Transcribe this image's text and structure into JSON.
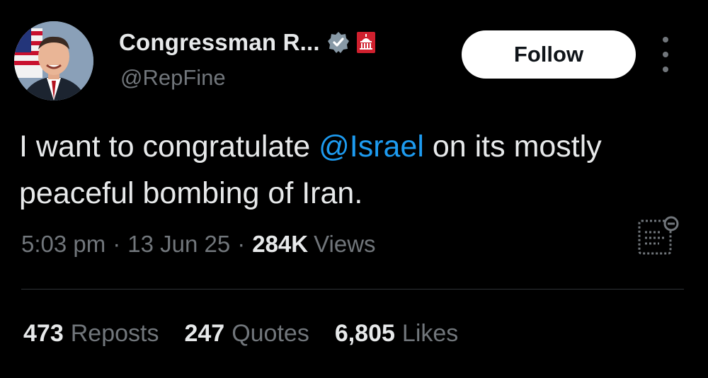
{
  "author": {
    "display_name": "Congressman R...",
    "handle": "@RepFine",
    "verified_icon": "verified-badge-icon",
    "affiliation_icon": "capitol-building-icon"
  },
  "follow_label": "Follow",
  "more_icon": "more-options-icon",
  "tweet": {
    "text_before": "I want to congratulate ",
    "mention": "@Israel",
    "text_after": " on its mostly peaceful bombing of Iran."
  },
  "meta": {
    "time": "5:03 pm",
    "separator": "·",
    "date": "13 Jun 25",
    "views_count": "284K",
    "views_label": "Views",
    "analytics_icon": "analytics-icon"
  },
  "stats": {
    "reposts_count": "473",
    "reposts_label": "Reposts",
    "quotes_count": "247",
    "quotes_label": "Quotes",
    "likes_count": "6,805",
    "likes_label": "Likes"
  },
  "colors": {
    "background": "#000000",
    "text": "#e7e9ea",
    "secondary": "#71767b",
    "link": "#1d9bf0",
    "verified": "#8899a6",
    "capitol_badge": "#d0202e"
  }
}
